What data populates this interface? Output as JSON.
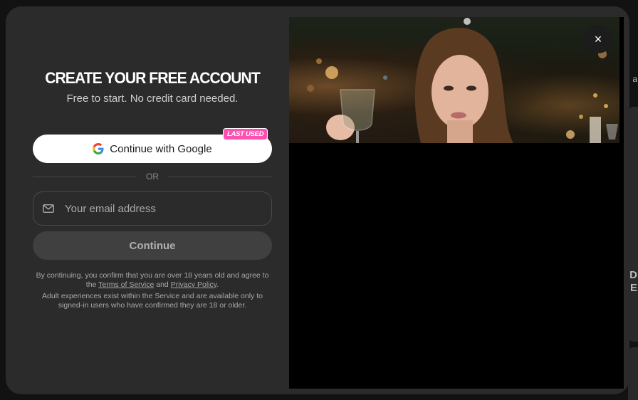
{
  "modal": {
    "title": "CREATE YOUR FREE ACCOUNT",
    "subtitle": "Free to start. No credit card needed.",
    "google_button": {
      "label": "Continue with Google",
      "icon": "google-icon",
      "badge": "LAST USED"
    },
    "divider_text": "OR",
    "email": {
      "icon": "mail-icon",
      "placeholder": "Your email address",
      "value": ""
    },
    "continue_label": "Continue",
    "legal": {
      "line1_prefix": "By continuing, you confirm that you are over 18 years old and agree to the",
      "terms_link": "Terms of Service",
      "and": "and",
      "privacy_link": "Privacy Policy",
      "period": ".",
      "line2": "Adult experiences exist within the Service and are available only to signed-in users who have confirmed they are 18 or older."
    },
    "close_icon": "close-icon",
    "close_glyph": "×"
  },
  "background": {
    "edge_text_1": "a",
    "edge_text_2": "D",
    "edge_text_3": "E"
  },
  "colors": {
    "modal_bg": "#2b2b2b",
    "badge": "#ff4fb0",
    "button_primary": "#ffffff",
    "button_disabled": "#404040"
  }
}
